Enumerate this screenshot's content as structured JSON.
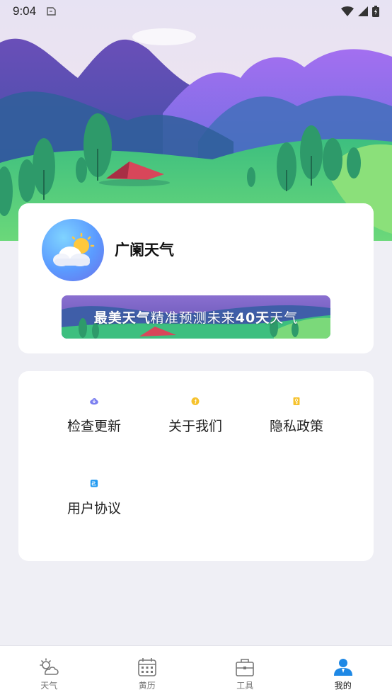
{
  "status": {
    "time": "9:04"
  },
  "app": {
    "name": "广阑天气"
  },
  "banner": {
    "part1": "最美天气",
    "part2": "精准预测未来",
    "part3": "40天",
    "part4": "天气"
  },
  "menu": [
    {
      "label": "检查更新",
      "icon": "cloud-download-icon"
    },
    {
      "label": "关于我们",
      "icon": "info-icon"
    },
    {
      "label": "隐私政策",
      "icon": "key-icon"
    },
    {
      "label": "用户协议",
      "icon": "agreement-icon"
    }
  ],
  "tabs": [
    {
      "label": "天气",
      "icon": "weather-icon"
    },
    {
      "label": "黄历",
      "icon": "calendar-icon"
    },
    {
      "label": "工具",
      "icon": "toolbox-icon"
    },
    {
      "label": "我的",
      "icon": "profile-icon",
      "active": true
    }
  ],
  "colors": {
    "accent": "#1e88e5",
    "card": "#ffffff",
    "background": "#efeff5"
  }
}
